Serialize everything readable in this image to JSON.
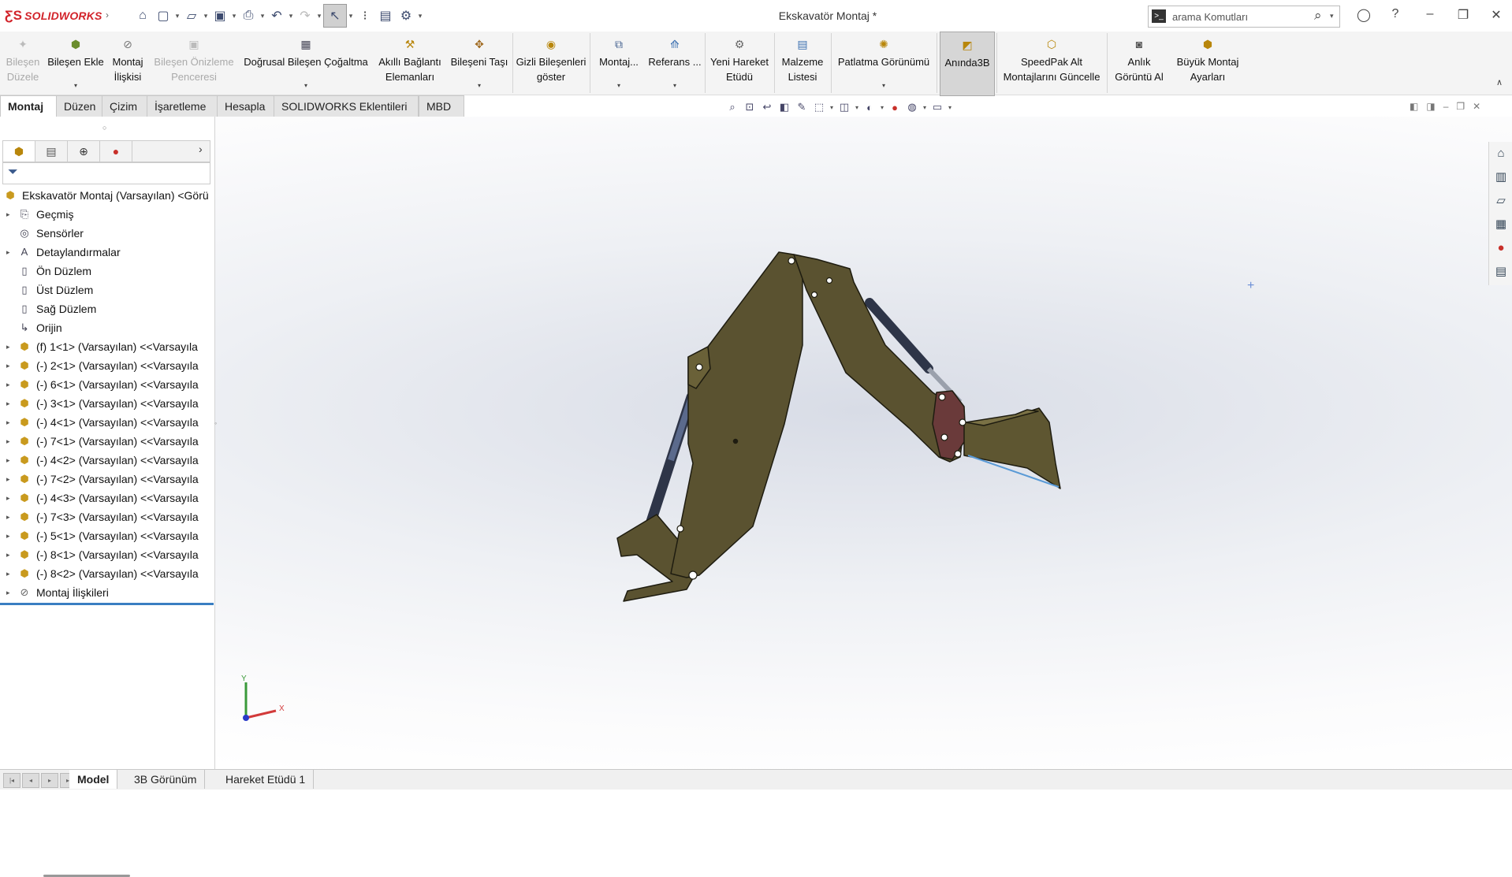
{
  "app": {
    "brand": "SOLIDWORKS",
    "document_title": "Ekskavatör Montaj *"
  },
  "search": {
    "placeholder": "arama Komutları"
  },
  "ribbon": {
    "items": [
      {
        "l1": "Bileşen",
        "l2": "Düzele",
        "disabled": true
      },
      {
        "l1": "Bileşen Ekle",
        "l2": ""
      },
      {
        "l1": "Montaj",
        "l2": "İlişkisi"
      },
      {
        "l1": "Bileşen Önizleme",
        "l2": "Penceresi",
        "disabled": true
      },
      {
        "l1": "Doğrusal Bileşen Çoğaltma",
        "l2": ""
      },
      {
        "l1": "Akıllı Bağlantı",
        "l2": "Elemanları"
      },
      {
        "l1": "Bileşeni Taşı",
        "l2": ""
      },
      {
        "l1": "Gizli Bileşenleri",
        "l2": "göster"
      },
      {
        "l1": "Montaj...",
        "l2": ""
      },
      {
        "l1": "Referans ...",
        "l2": ""
      },
      {
        "l1": "Yeni Hareket",
        "l2": "Etüdü"
      },
      {
        "l1": "Malzeme",
        "l2": "Listesi"
      },
      {
        "l1": "Patlatma Görünümü",
        "l2": ""
      },
      {
        "l1": "Anında3B",
        "l2": "",
        "active": true
      },
      {
        "l1": "SpeedPak Alt",
        "l2": "Montajlarını Güncelle"
      },
      {
        "l1": "Anlık",
        "l2": "Görüntü Al"
      },
      {
        "l1": "Büyük Montaj",
        "l2": "Ayarları"
      }
    ]
  },
  "command_tabs": [
    "Montaj",
    "Düzen",
    "Çizim",
    "İşaretleme",
    "Hesapla",
    "SOLIDWORKS Eklentileri",
    "MBD"
  ],
  "tree": {
    "root": "Ekskavatör Montaj (Varsayılan) <Görü",
    "items": [
      {
        "label": "Geçmiş",
        "expandable": true,
        "icon": "history-icon"
      },
      {
        "label": "Sensörler",
        "expandable": false,
        "icon": "sensor-icon"
      },
      {
        "label": "Detaylandırmalar",
        "expandable": true,
        "icon": "annotation-icon"
      },
      {
        "label": "Ön Düzlem",
        "expandable": false,
        "icon": "plane-icon"
      },
      {
        "label": "Üst Düzlem",
        "expandable": false,
        "icon": "plane-icon"
      },
      {
        "label": "Sağ Düzlem",
        "expandable": false,
        "icon": "plane-icon"
      },
      {
        "label": "Orijin",
        "expandable": false,
        "icon": "origin-icon"
      },
      {
        "label": "(f) 1<1> (Varsayılan) <<Varsayıla",
        "expandable": true,
        "icon": "part-icon"
      },
      {
        "label": "(-) 2<1> (Varsayılan) <<Varsayıla",
        "expandable": true,
        "icon": "part-icon"
      },
      {
        "label": "(-) 6<1> (Varsayılan) <<Varsayıla",
        "expandable": true,
        "icon": "part-icon"
      },
      {
        "label": "(-) 3<1> (Varsayılan) <<Varsayıla",
        "expandable": true,
        "icon": "part-icon"
      },
      {
        "label": "(-) 4<1> (Varsayılan) <<Varsayıla",
        "expandable": true,
        "icon": "part-icon"
      },
      {
        "label": "(-) 7<1> (Varsayılan) <<Varsayıla",
        "expandable": true,
        "icon": "part-icon"
      },
      {
        "label": "(-) 4<2> (Varsayılan) <<Varsayıla",
        "expandable": true,
        "icon": "part-icon"
      },
      {
        "label": "(-) 7<2> (Varsayılan) <<Varsayıla",
        "expandable": true,
        "icon": "part-icon"
      },
      {
        "label": "(-) 4<3> (Varsayılan) <<Varsayıla",
        "expandable": true,
        "icon": "part-icon"
      },
      {
        "label": "(-) 7<3> (Varsayılan) <<Varsayıla",
        "expandable": true,
        "icon": "part-icon"
      },
      {
        "label": "(-) 5<1> (Varsayılan) <<Varsayıla",
        "expandable": true,
        "icon": "part-icon"
      },
      {
        "label": "(-) 8<1> (Varsayılan) <<Varsayıla",
        "expandable": true,
        "icon": "part-icon"
      },
      {
        "label": "(-) 8<2> (Varsayılan) <<Varsayıla",
        "expandable": true,
        "icon": "part-icon"
      },
      {
        "label": "Montaj İlişkileri",
        "expandable": true,
        "icon": "mates-icon"
      }
    ]
  },
  "bottom_tabs": [
    "Model",
    "3B Görünüm",
    "Hareket Etüdü 1"
  ],
  "triad": {
    "y": "Y",
    "x": "X"
  },
  "colors": {
    "part": "#5a5230",
    "cylinder": "#3e4a66",
    "accent": "#3a7ec2"
  }
}
